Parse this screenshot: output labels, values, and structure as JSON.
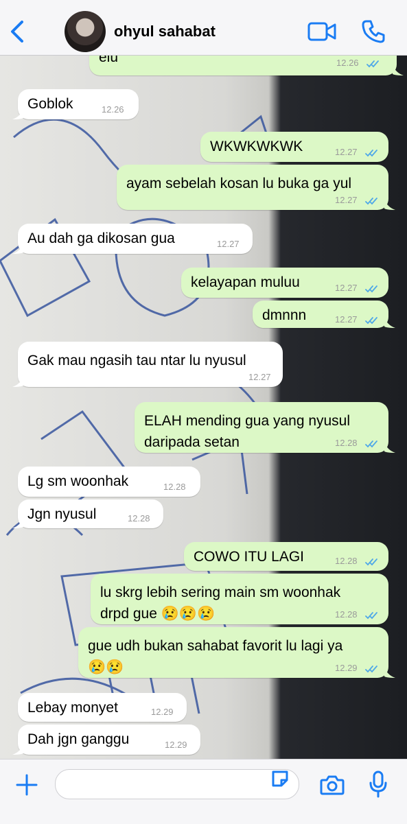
{
  "header": {
    "contact_name": "ohyul sahabat",
    "icons": [
      "back-chevron-icon",
      "avatar",
      "video-call-icon",
      "phone-icon"
    ],
    "accent_color": "#1a7cf3"
  },
  "messages": [
    {
      "dir": "out",
      "text": "elu",
      "time": "12.26",
      "read": true
    },
    {
      "dir": "in",
      "text": "Goblok",
      "time": "12.26"
    },
    {
      "dir": "out",
      "text": "WKWKWKWK",
      "time": "12.27",
      "read": true
    },
    {
      "dir": "out",
      "text": "ayam sebelah kosan lu buka ga yul",
      "time": "12.27",
      "read": true
    },
    {
      "dir": "in",
      "text": "Au dah ga dikosan gua",
      "time": "12.27"
    },
    {
      "dir": "out",
      "text": "kelayapan muluu",
      "time": "12.27",
      "read": true
    },
    {
      "dir": "out",
      "text": "dmnnn",
      "time": "12.27",
      "read": true
    },
    {
      "dir": "in",
      "text": "Gak mau ngasih tau ntar lu nyusul",
      "time": "12.27"
    },
    {
      "dir": "out",
      "text": "ELAH mending gua yang nyusul\ndaripada setan",
      "time": "12.28",
      "read": true
    },
    {
      "dir": "in",
      "text": "Lg sm woonhak",
      "time": "12.28"
    },
    {
      "dir": "in",
      "text": "Jgn nyusul",
      "time": "12.28"
    },
    {
      "dir": "out",
      "text": "COWO ITU LAGI",
      "time": "12.28",
      "read": true
    },
    {
      "dir": "out",
      "text": "lu skrg lebih sering main sm woonhak\ndrpd gue 😢😢😢",
      "time": "12.28",
      "read": true
    },
    {
      "dir": "out",
      "text": "gue udh bukan sahabat favorit lu lagi ya\n😢😢",
      "time": "12.29",
      "read": true
    },
    {
      "dir": "in",
      "text": "Lebay monyet",
      "time": "12.29"
    },
    {
      "dir": "in",
      "text": "Dah jgn ganggu",
      "time": "12.29"
    }
  ],
  "composer": {
    "value": "",
    "icons": [
      "plus-icon",
      "sticker-icon",
      "camera-icon",
      "microphone-icon"
    ]
  },
  "colors": {
    "outgoing_bubble": "#dcf8c6",
    "incoming_bubble": "#ffffff",
    "read_ticks": "#4fa8e8"
  }
}
